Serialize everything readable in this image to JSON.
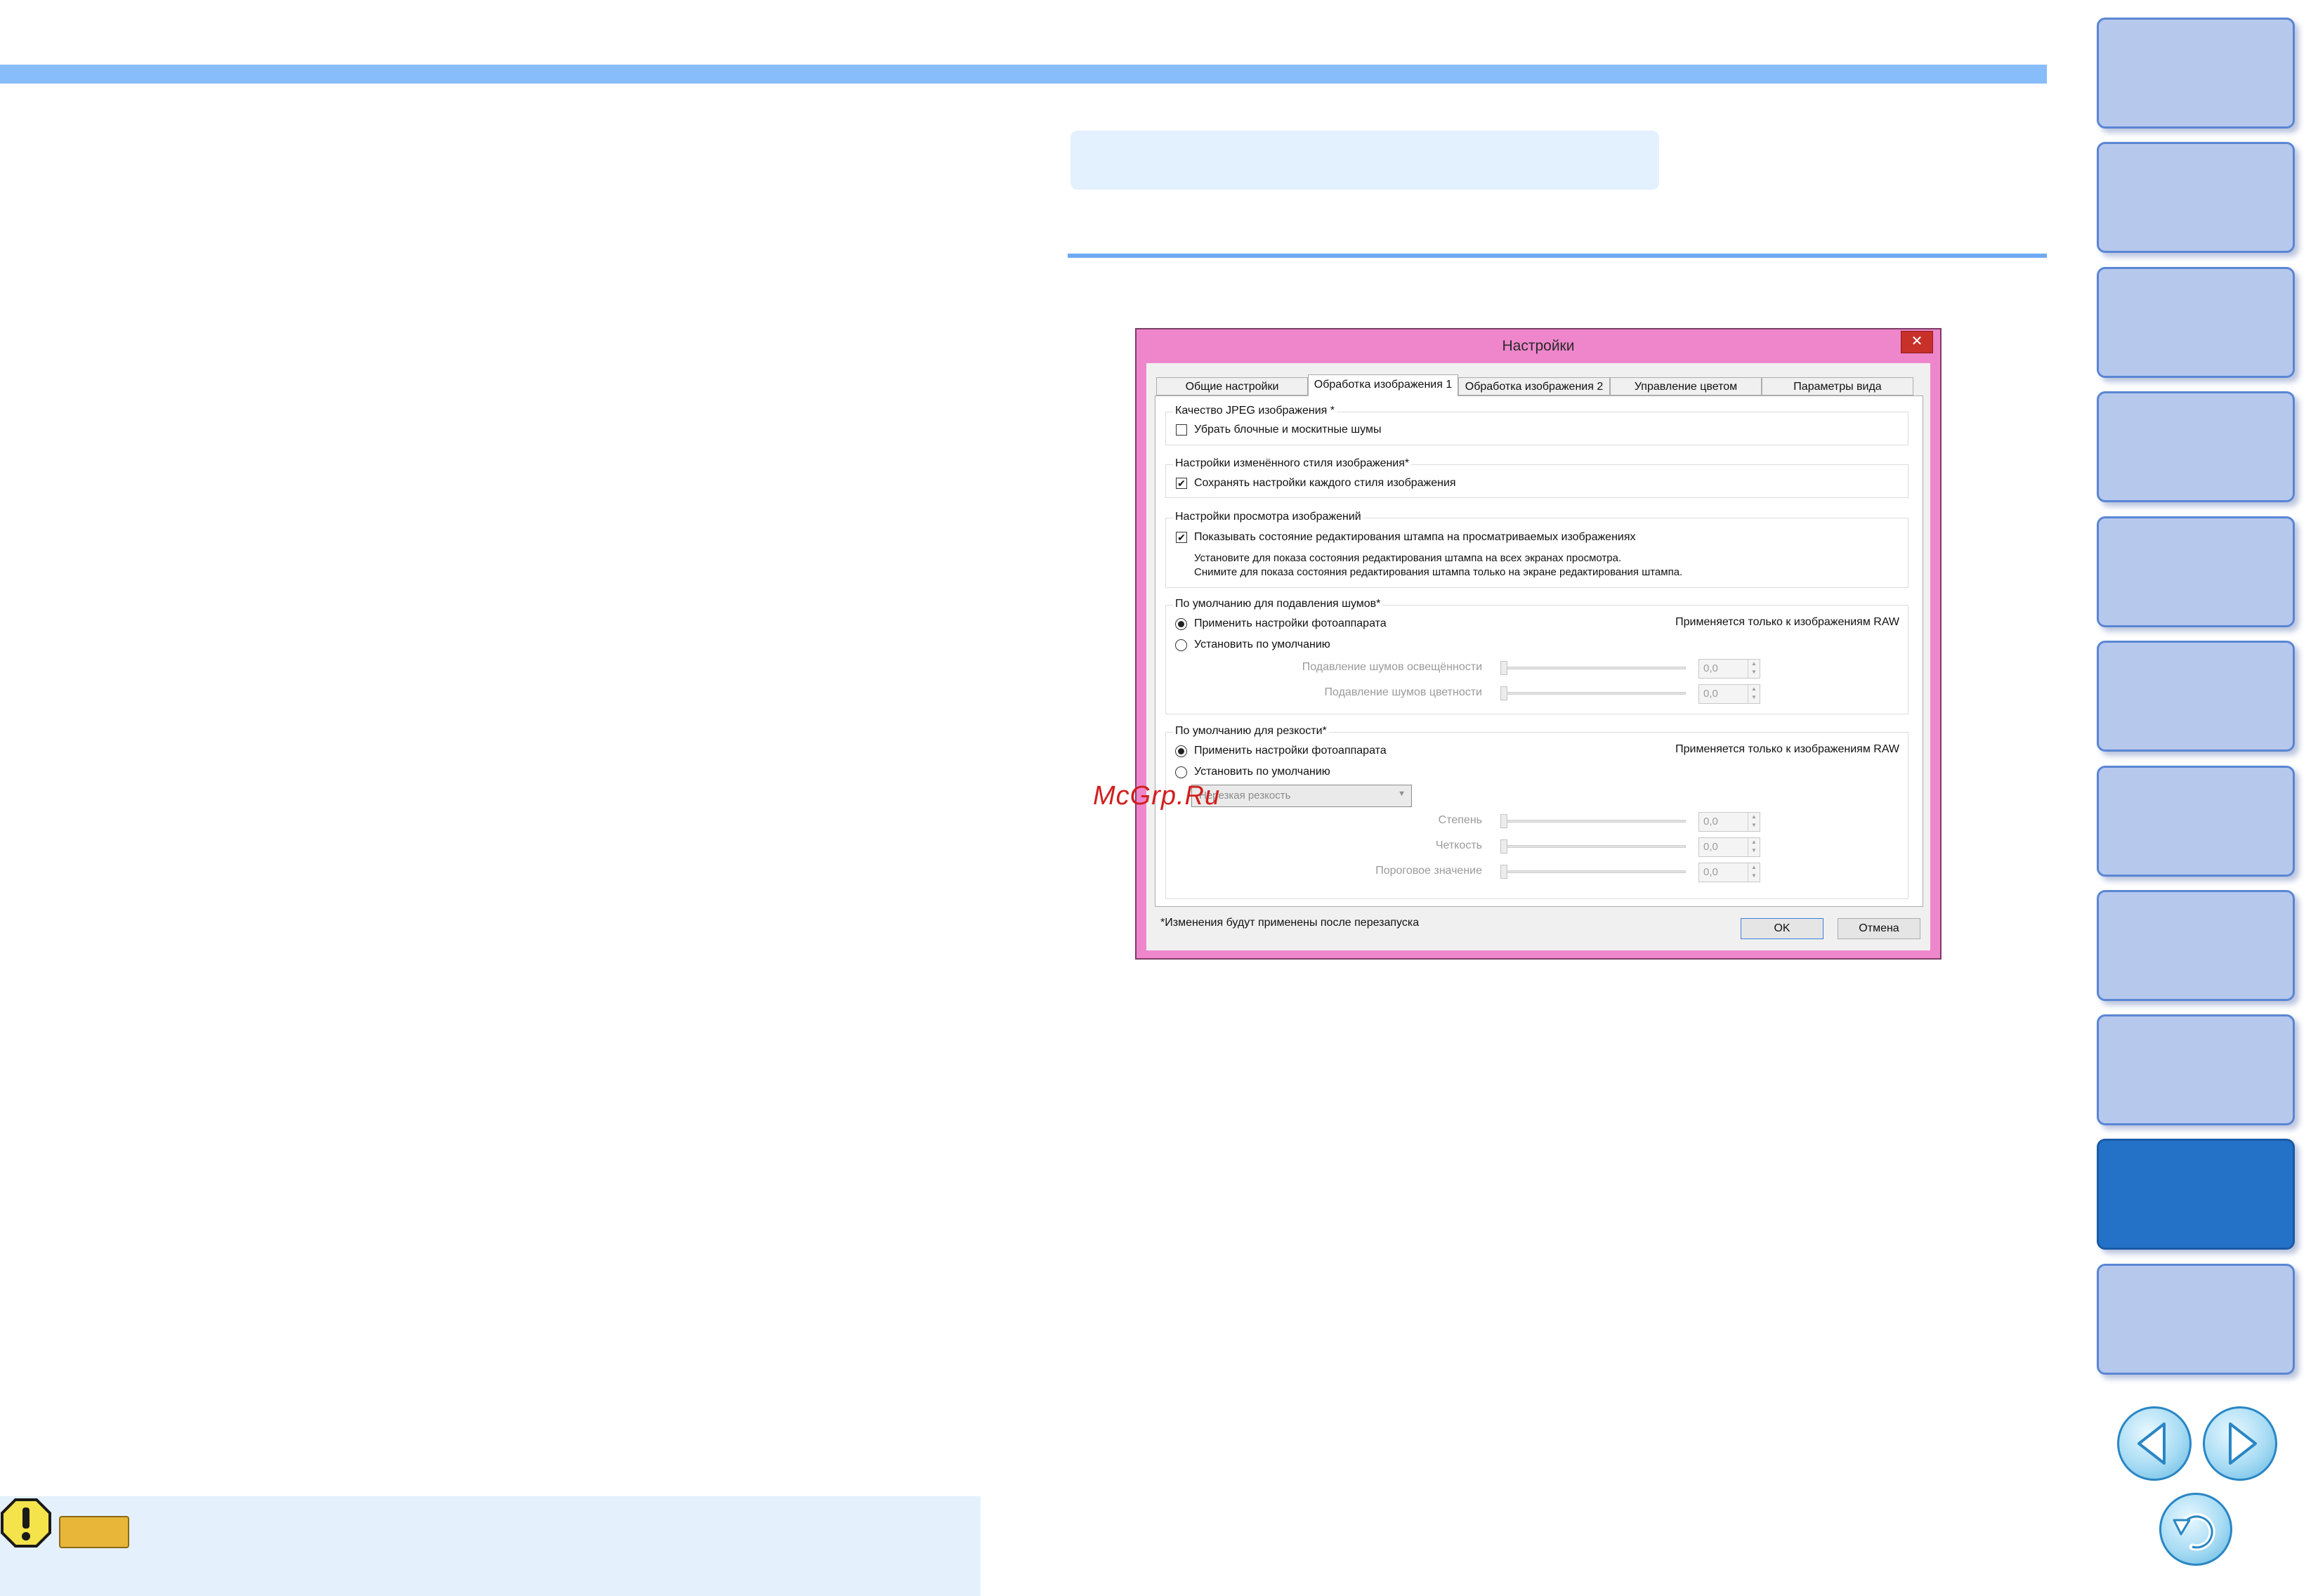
{
  "dialog": {
    "title": "Настройки",
    "close_icon": "close-icon",
    "tabs": [
      {
        "label": "Общие настройки",
        "active": false
      },
      {
        "label": "Обработка изображения 1",
        "active": true
      },
      {
        "label": "Обработка изображения 2",
        "active": false
      },
      {
        "label": "Управление цветом",
        "active": false
      },
      {
        "label": "Параметры вида",
        "active": false
      }
    ],
    "jpeg_group": {
      "title": "Качество JPEG изображения *",
      "checkbox_label": "Убрать блочные и москитные шумы",
      "checked": false
    },
    "style_group": {
      "title": "Настройки изменённого стиля изображения*",
      "checkbox_label": "Сохранять настройки каждого стиля изображения",
      "checked": true
    },
    "view_group": {
      "title": "Настройки просмотра изображений",
      "checkbox_label": "Показывать состояние редактирования штампа на просматриваемых изображениях",
      "checked": true,
      "note_line1": "Установите для показа состояния редактирования штампа на всех экранах просмотра.",
      "note_line2": "Снимите для показа состояния редактирования штампа только на экране редактирования штампа."
    },
    "noise_group": {
      "title": "По умолчанию для подавления шумов*",
      "radio_camera": "Применить настройки фотоаппарата",
      "radio_default": "Установить по умолчанию",
      "selected": "camera",
      "raw_note": "Применяется только к изображениям RAW",
      "luminance_label": "Подавление шумов освещённости",
      "luminance_value": "0,0",
      "chroma_label": "Подавление шумов цветности",
      "chroma_value": "0,0"
    },
    "sharp_group": {
      "title": "По умолчанию для резкости*",
      "radio_camera": "Применить настройки фотоаппарата",
      "radio_default": "Установить по умолчанию",
      "selected": "camera",
      "raw_note": "Применяется только к изображениям RAW",
      "mode_value": "Нерезкая резкость",
      "strength_label": "Степень",
      "strength_value": "0,0",
      "fineness_label": "Четкость",
      "fineness_value": "0,0",
      "threshold_label": "Пороговое значение",
      "threshold_value": "0,0"
    },
    "footnote": "*Изменения будут применены после перезапуска",
    "ok_label": "OK",
    "cancel_label": "Отмена"
  },
  "watermark": "McGrp.Ru",
  "sidebar": {
    "tab_count": 11,
    "active_index": 9,
    "prev_icon": "prev-page-icon",
    "next_icon": "next-page-icon",
    "return_icon": "return-icon"
  },
  "caution": {
    "icon": "caution-icon"
  },
  "colors": {
    "accent_bar": "#88bdfc",
    "dialog_frame": "#ef86cc",
    "active_tab": "#2472c8",
    "caution_tag": "#e8b739"
  }
}
